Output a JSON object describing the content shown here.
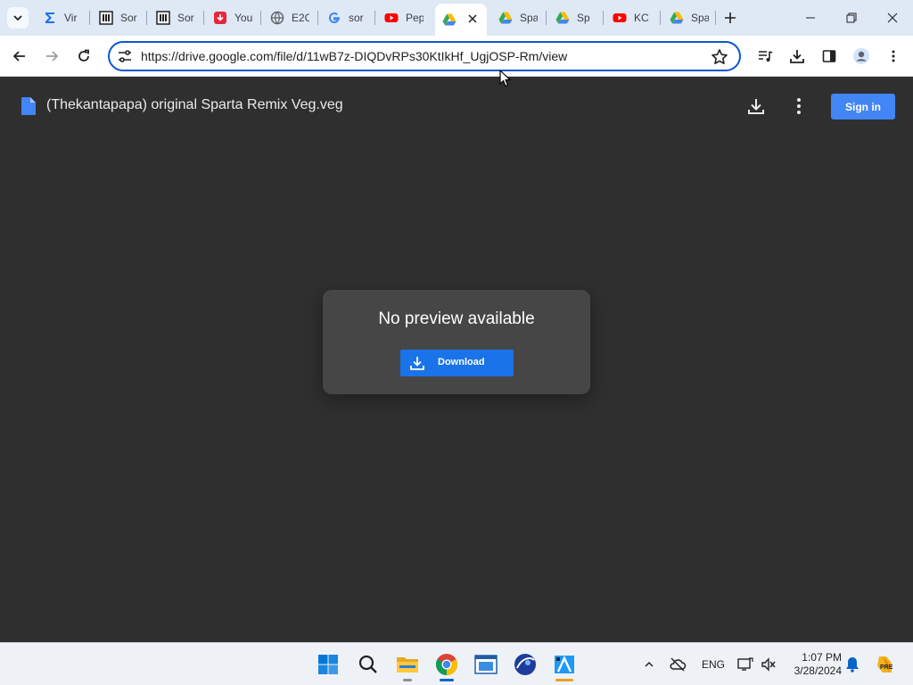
{
  "browser": {
    "tabs": [
      {
        "title": "Vir",
        "icon": "sigma-icon",
        "active": false
      },
      {
        "title": "Sor",
        "icon": "archive-icon",
        "active": false
      },
      {
        "title": "Sor",
        "icon": "archive-icon",
        "active": false
      },
      {
        "title": "You",
        "icon": "youtube-downloader-icon",
        "active": false
      },
      {
        "title": "E2C",
        "icon": "globe-icon",
        "active": false
      },
      {
        "title": "sor",
        "icon": "google-icon",
        "active": false
      },
      {
        "title": "Pep",
        "icon": "youtube-icon",
        "active": false
      },
      {
        "title": "",
        "icon": "google-drive-icon",
        "active": true
      },
      {
        "title": "Spa",
        "icon": "google-drive-icon",
        "active": false
      },
      {
        "title": "Sp",
        "icon": "google-drive-icon",
        "active": false
      },
      {
        "title": "KC",
        "icon": "youtube-icon",
        "active": false
      },
      {
        "title": "Spa",
        "icon": "google-drive-icon",
        "active": false
      }
    ],
    "url": "https://drive.google.com/file/d/11wB7z-DIQDvRPs30KtIkHf_UgjOSP-Rm/view"
  },
  "viewer": {
    "file_title": "(Thekantapapa) original Sparta Remix Veg.veg",
    "sign_in_label": "Sign in",
    "no_preview_text": "No preview available",
    "download_label": "Download"
  },
  "taskbar": {
    "apps": [
      "windows-start",
      "search",
      "file-explorer",
      "chrome",
      "window-app",
      "sphere-app",
      "kdenlive"
    ],
    "language": "ENG",
    "time": "1:07 PM",
    "date": "3/28/2024",
    "badge": "PRE"
  },
  "colors": {
    "accent": "#1a73e8",
    "sign_in": "#4285f4",
    "viewer_bg": "#2f2f2f",
    "card_bg": "#464646"
  }
}
